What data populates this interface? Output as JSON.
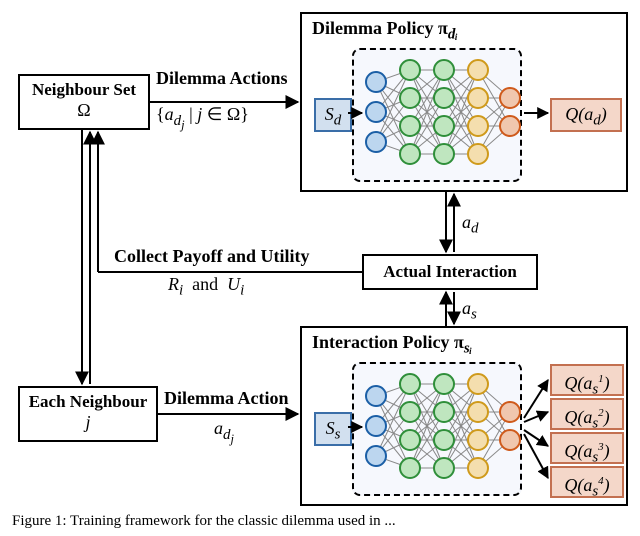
{
  "neighbour_set": {
    "title": "Neighbour Set",
    "symbol": "Ω"
  },
  "each_neighbour": {
    "title": "Each Neighbour",
    "symbol": "j"
  },
  "actual_interaction": {
    "label": "Actual Interaction"
  },
  "dilemma_panel": {
    "title": "Dilemma Policy π",
    "subscript": "dᵢ",
    "state": "S_d",
    "qlabel": "Q(a_d)"
  },
  "interaction_panel": {
    "title": "Interaction Policy π",
    "subscript": "sᵢ",
    "state": "S_s",
    "q": [
      "Q(a_s^1)",
      "Q(a_s^2)",
      "Q(a_s^3)",
      "Q(a_s^4)"
    ]
  },
  "labels": {
    "dilemma_actions_top": "Dilemma Actions",
    "dilemma_actions_set": "{a_{d_j} | j ∈ Ω}",
    "collect": "Collect Payoff and Utility",
    "ru": "Rᵢ  and  Uᵢ",
    "dilemma_action_bot": "Dilemma Action",
    "adj": "a_{d_j}",
    "ad": "a_d",
    "as": "a_s"
  },
  "caption": "Figure 1: Training framework for the classic dilemma used in ...",
  "chart_data": {
    "type": "diagram",
    "title": "Training framework diagram",
    "nodes": [
      {
        "id": "neighbour_set",
        "label": "Neighbour Set Ω"
      },
      {
        "id": "each_neighbour",
        "label": "Each Neighbour j"
      },
      {
        "id": "actual_interaction",
        "label": "Actual Interaction"
      },
      {
        "id": "dilemma_policy",
        "label": "Dilemma Policy π_{d_i}",
        "inputs": [
          "S_d"
        ],
        "outputs": [
          "Q(a_d)"
        ]
      },
      {
        "id": "interaction_policy",
        "label": "Interaction Policy π_{s_i}",
        "inputs": [
          "S_s"
        ],
        "outputs": [
          "Q(a_s^1)",
          "Q(a_s^2)",
          "Q(a_s^3)",
          "Q(a_s^4)"
        ]
      }
    ],
    "edges": [
      {
        "from": "neighbour_set",
        "to": "dilemma_policy",
        "label": "Dilemma Actions {a_{d_j} | j ∈ Ω}",
        "dir": "→"
      },
      {
        "from": "actual_interaction",
        "to": "neighbour_set",
        "label": "Collect Payoff and Utility Rᵢ and Uᵢ",
        "dir": "→"
      },
      {
        "from": "dilemma_policy",
        "to": "actual_interaction",
        "label": "a_d",
        "dir": "↔"
      },
      {
        "from": "interaction_policy",
        "to": "actual_interaction",
        "label": "a_s",
        "dir": "↔"
      },
      {
        "from": "each_neighbour",
        "to": "interaction_policy",
        "label": "Dilemma Action a_{d_j}",
        "dir": "→"
      },
      {
        "from": "neighbour_set",
        "to": "each_neighbour",
        "dir": "↔"
      }
    ]
  }
}
